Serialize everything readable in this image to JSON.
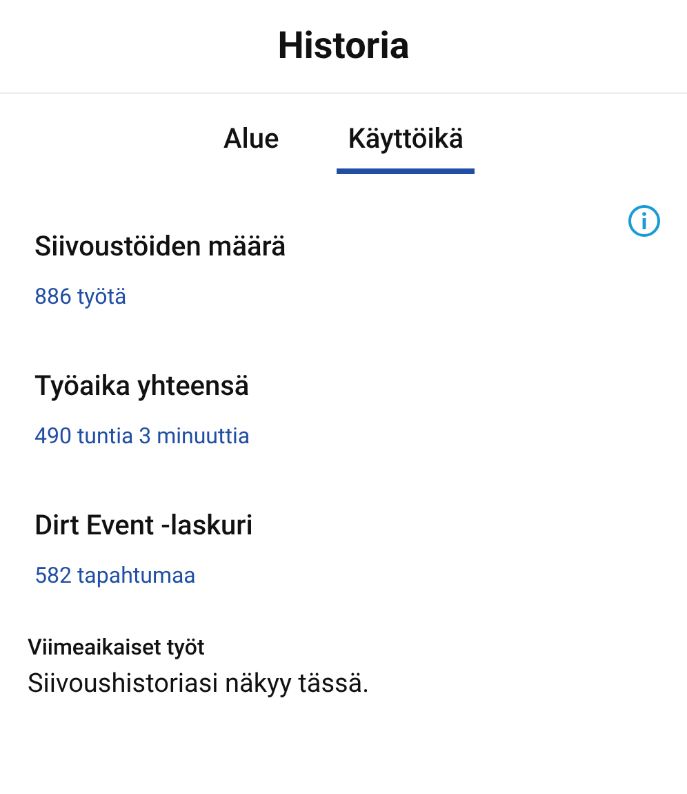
{
  "header": {
    "title": "Historia"
  },
  "tabs": [
    {
      "label": "Alue",
      "selected": false
    },
    {
      "label": "Käyttöikä",
      "selected": true
    }
  ],
  "stats": [
    {
      "title": "Siivoustöiden määrä",
      "value": "886 työtä"
    },
    {
      "title": "Työaika yhteensä",
      "value": "490 tuntia 3 minuuttia"
    },
    {
      "title": "Dirt Event -laskuri",
      "value": "582 tapahtumaa"
    }
  ],
  "recent": {
    "title": "Viimeaikaiset työt",
    "message": "Siivoushistoriasi näkyy tässä."
  }
}
